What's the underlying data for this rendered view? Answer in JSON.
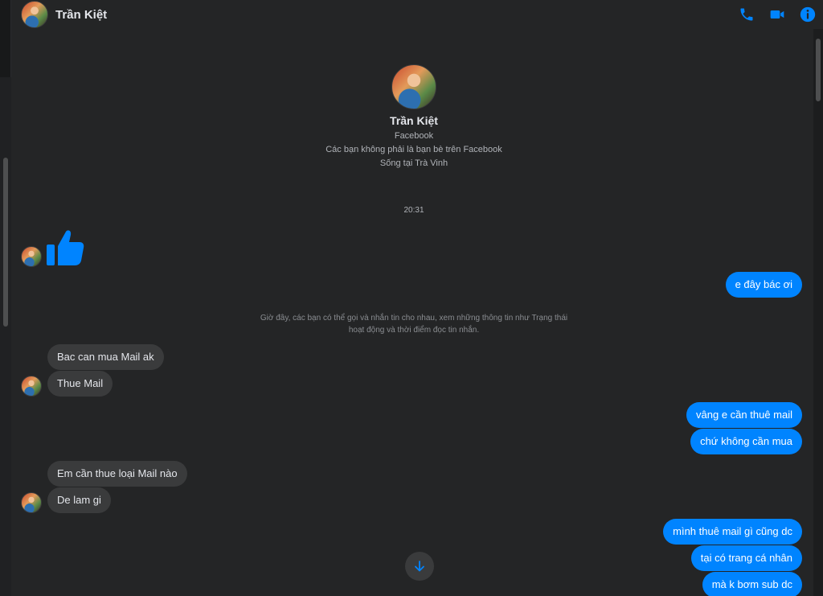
{
  "header": {
    "contact_name": "Trần Kiệt",
    "icons": [
      "phone-icon",
      "video-camera-icon",
      "info-icon"
    ]
  },
  "intro": {
    "name": "Trần Kiệt",
    "platform": "Facebook",
    "friend_status": "Các bạn không phải là bạn bè trên Facebook",
    "location": "Sống tại Trà Vinh"
  },
  "timestamp": "20:31",
  "system_note": {
    "line1": "Giờ đây, các bạn có thể gọi và nhắn tin cho nhau, xem những thông tin như Trạng thái",
    "line2": "hoạt động và thời điểm đọc tin nhắn."
  },
  "messages": {
    "out_1": "e đây bác ơi",
    "in_1": "Bac can mua Mail ak",
    "in_2": "Thue Mail",
    "out_2": "vâng e cần thuê mail",
    "out_3": "chứ không cần mua",
    "in_3": "Em cần thue loại Mail nào",
    "in_4": "De lam gi",
    "out_4": "mình thuê mail gì cũng dc",
    "out_5": "tại có trang cá nhân",
    "out_6": "mà k bơm sub dc"
  },
  "colors": {
    "accent": "#0084ff",
    "background": "#242526",
    "incoming_bubble": "#3a3b3c"
  }
}
